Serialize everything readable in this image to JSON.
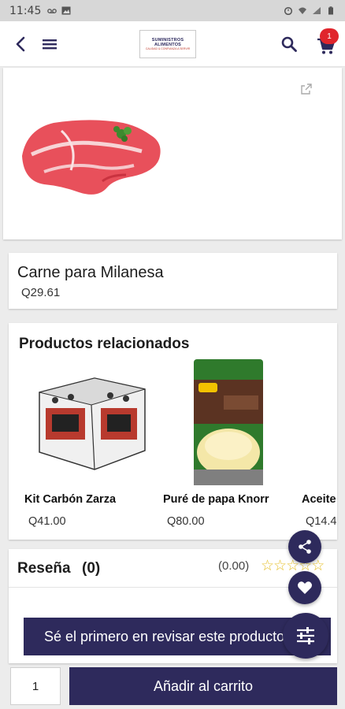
{
  "status_bar": {
    "time": "11:45"
  },
  "header": {
    "logo_line1": "SUMINISTROS",
    "logo_line2": "ALIMENTOS",
    "logo_line3": "CALIDAD & CONFIANZA A SERVIR",
    "cart_count": "1"
  },
  "product": {
    "name": "Carne para Milanesa",
    "price": "Q29.61"
  },
  "related": {
    "title": "Productos relacionados",
    "items": [
      {
        "name": "Kit Carbón Zarza",
        "price": "Q41.00"
      },
      {
        "name": "Puré de papa Knorr",
        "price": "Q80.00"
      },
      {
        "name": "Aceite",
        "price": "Q14.4"
      }
    ]
  },
  "reviews": {
    "title": "Reseña",
    "count": "(0)",
    "rating": "(0.00)",
    "stars_filled": 0,
    "first_review_label": "Sé el primero en revisar este producto"
  },
  "cart_bar": {
    "quantity": "1",
    "add_label": "Añadir al carrito"
  },
  "colors": {
    "primary": "#2e2a5c",
    "badge": "#e0252c",
    "star": "#e7c12e"
  }
}
